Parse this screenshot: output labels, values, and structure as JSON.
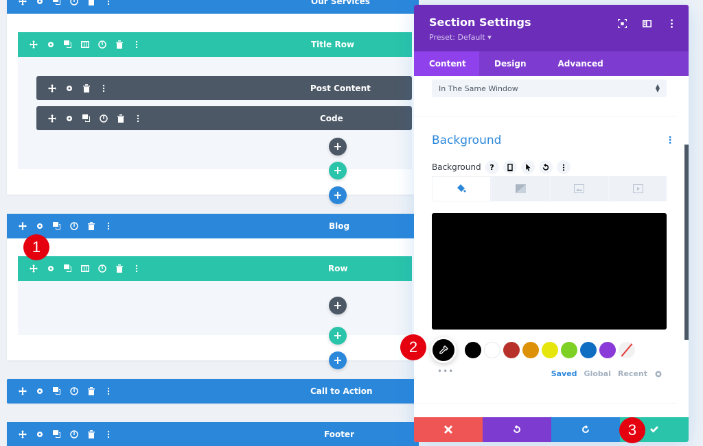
{
  "builder": {
    "sections": [
      {
        "label": "Our Services"
      },
      {
        "label": "Blog"
      },
      {
        "label": "Call to Action"
      },
      {
        "label": "Footer"
      }
    ],
    "rows": [
      {
        "label": "Title Row"
      },
      {
        "label": "Row"
      }
    ],
    "modules": [
      {
        "label": "Post Content"
      },
      {
        "label": "Code"
      }
    ],
    "add_symbol": "+"
  },
  "badges": [
    "1",
    "2",
    "3"
  ],
  "panel": {
    "title": "Section Settings",
    "preset": "Preset: Default ▾",
    "tabs": [
      "Content",
      "Design",
      "Advanced"
    ],
    "link_target_value": "In The Same Window",
    "background_heading": "Background",
    "background_label": "Background",
    "help_symbol": "?",
    "kebab": "⋮",
    "swatch_colors": {
      "picker": "#000000",
      "black": "#000000",
      "white": "#ffffff",
      "red": "#b8302a",
      "orange": "#dd9108",
      "yellow": "#e6e60c",
      "green": "#7ed124",
      "blue": "#0f6ec1",
      "purple": "#8a3ad8"
    },
    "more_dots": "•••",
    "palette_tabs": [
      "Saved",
      "Global",
      "Recent"
    ],
    "preview_color": "#000000"
  },
  "colors": {
    "section": "#2b87da",
    "row": "#29c4a9",
    "module": "#4c5866",
    "panel_header": "#6c2eb9",
    "panel_tabs": "#7e3bd0"
  }
}
